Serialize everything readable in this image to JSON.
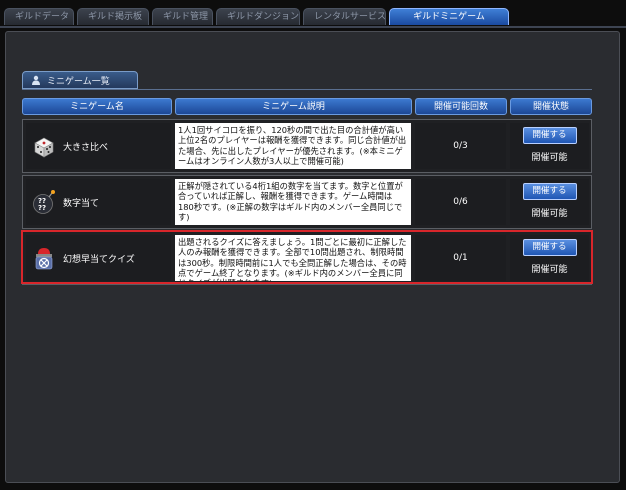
{
  "tabs": [
    {
      "label": "ギルドデータ",
      "active": false
    },
    {
      "label": "ギルド掲示板",
      "active": false
    },
    {
      "label": "ギルド管理",
      "active": false
    },
    {
      "label": "ギルドダンジョン",
      "active": false
    },
    {
      "label": "レンタルサービス",
      "active": false
    },
    {
      "label": "ギルドミニゲーム",
      "active": true
    }
  ],
  "section": {
    "title": "ミニゲーム一覧",
    "icon": "person-icon"
  },
  "table": {
    "headers": [
      "ミニゲーム名",
      "ミニゲーム説明",
      "開催可能回数",
      "開催状態"
    ],
    "rows": [
      {
        "name": "大きさ比べ",
        "icon": "dice-icon",
        "description": "1人1回サイコロを振り、120秒の間で出た目の合計値が高い上位2名のプレイヤーは報酬を獲得できます。同じ合計値が出た場合、先に出したプレイヤーが優先されます。(※本ミニゲームはオンライン人数が3人以上で開催可能)",
        "count": "0/3",
        "button": "開催する",
        "status": "開催可能",
        "highlighted": false
      },
      {
        "name": "数字当て",
        "icon": "number-bomb-icon",
        "description": "正解が隠されている4桁1組の数字を当てます。数字と位置が合っていれば正解し、報酬を獲得できます。ゲーム時間は180秒です。(※正解の数字はギルド内のメンバー全員同じです)",
        "count": "0/6",
        "button": "開催する",
        "status": "開催可能",
        "highlighted": false
      },
      {
        "name": "幻想早当てクイズ",
        "icon": "quiz-buzzer-icon",
        "description": "出題されるクイズに答えましょう。1問ごとに最初に正解した人のみ報酬を獲得できます。全部で10問出題され、制限時間は300秒。制限時間前に1人でも全問正解した場合は、その時点でゲーム終了となります。(※ギルド内のメンバー全員に同じクイズが出題されます)",
        "count": "0/1",
        "button": "開催する",
        "status": "開催可能",
        "highlighted": true
      }
    ]
  },
  "colors": {
    "highlight": "#d8262b",
    "accent": "#2a62c4"
  }
}
